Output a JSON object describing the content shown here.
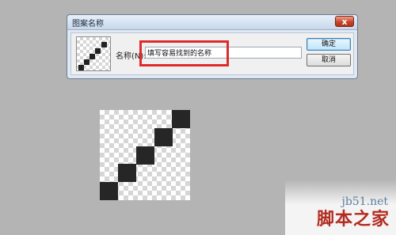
{
  "dialog": {
    "title": "图案名称",
    "close_glyph": "x",
    "name_label": "名称(N):",
    "name_value": "填写容易找到的名称",
    "ok_label": "确定",
    "cancel_label": "取消"
  },
  "watermark": {
    "url": "jb51.net",
    "text": "脚本之家"
  }
}
